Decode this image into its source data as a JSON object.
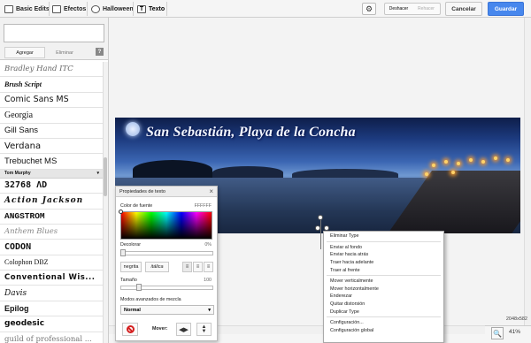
{
  "toolbar": {
    "tabs": [
      {
        "label": "Basic Edits"
      },
      {
        "label": "Efectos"
      },
      {
        "label": "Halloween"
      },
      {
        "label": "Texto"
      }
    ],
    "undo_label": "Deshacer",
    "redo_label": "Rehacer",
    "cancel_label": "Cancelar",
    "save_label": "Guardar",
    "accent_color": "#4787ed"
  },
  "text_panel": {
    "add_label": "Agregar",
    "delete_label": "Eliminar",
    "help_label": "?",
    "text_value": ""
  },
  "fonts": [
    {
      "name": "Bradley Hand ITC"
    },
    {
      "name": "Brush Script"
    },
    {
      "name": "Comic Sans MS"
    },
    {
      "name": "Georgia"
    },
    {
      "name": "Gill Sans"
    },
    {
      "name": "Verdana"
    },
    {
      "name": "Trebuchet MS"
    },
    {
      "name": "Tom Murphy"
    },
    {
      "name": "32768 ΛD"
    },
    {
      "name": "Action Jackson"
    },
    {
      "name": "ANGSTROM"
    },
    {
      "name": "Anthem Blues"
    },
    {
      "name": "CODON"
    },
    {
      "name": "Colophon DBZ"
    },
    {
      "name": "Conventional Wis..."
    },
    {
      "name": "Davis"
    },
    {
      "name": "Epilog"
    },
    {
      "name": "geodesic"
    },
    {
      "name": "guild of professional ..."
    }
  ],
  "photo": {
    "title": "San Sebastián, Playa de la Concha"
  },
  "properties": {
    "title": "Propiedades de texto",
    "close_label": "×",
    "font_color_label": "Color de fuente",
    "font_color_value": "FFFFFF",
    "fade_label": "Decolorar",
    "fade_value": "0%",
    "fade_level": 0,
    "bold_label": "negrita",
    "italic_label": "itálica",
    "size_label": "Tamaño",
    "size_value": "100",
    "size_level": 0.18,
    "blend_label": "Modos avanzados de mezcla",
    "blend_value": "Normal",
    "move_label": "Mover:"
  },
  "context_menu": {
    "groups": [
      [
        "Eliminar Type"
      ],
      [
        "Enviar al fondo",
        "Enviar hacia atrás",
        "Traer hacia adelante",
        "Traer al frente"
      ],
      [
        "Mover verticalmente",
        "Mover horizontalmente",
        "Enderezar",
        "Quitar distorsión",
        "Duplicar Type"
      ],
      [
        "Configuración...",
        "Configuración global"
      ]
    ]
  },
  "status": {
    "dimensions": "2048x582",
    "zoom": "41%"
  }
}
